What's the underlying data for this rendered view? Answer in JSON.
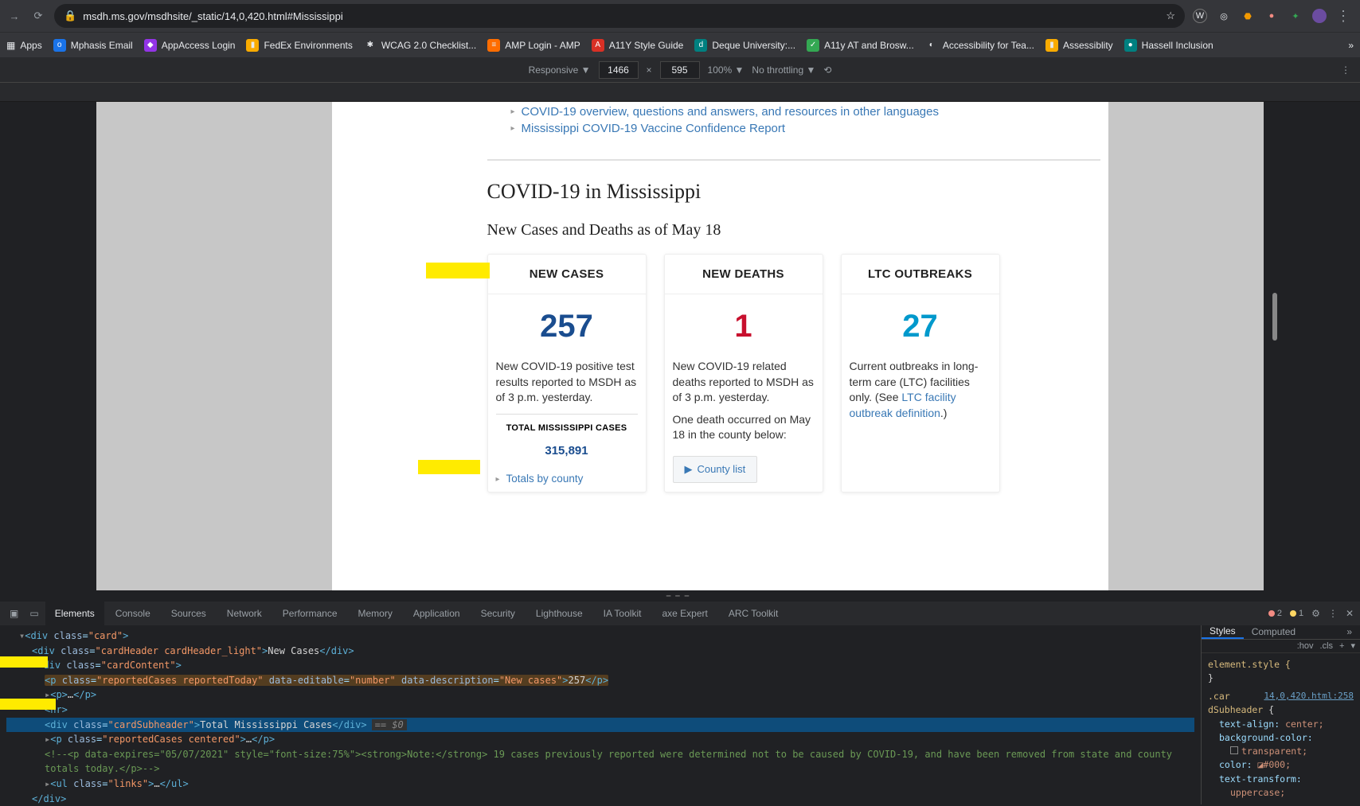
{
  "browser": {
    "url": "msdh.ms.gov/msdhsite/_static/14,0,420.html#Mississippi",
    "star_icon": "star-icon",
    "ext_icons": [
      "wallet",
      "eye",
      "shield",
      "lock",
      "puzzle",
      "avatar"
    ],
    "apps_label": "Apps",
    "bookmarks": [
      {
        "label": "Mphasis Email",
        "color": "bm-blue"
      },
      {
        "label": "AppAccess Login",
        "color": "bm-purple"
      },
      {
        "label": "FedEx Environments",
        "color": "bm-yellow"
      },
      {
        "label": "WCAG 2.0 Checklist...",
        "color": ""
      },
      {
        "label": "AMP Login - AMP",
        "color": "bm-orange"
      },
      {
        "label": "A11Y Style Guide",
        "color": "bm-red"
      },
      {
        "label": "Deque University:...",
        "color": "bm-teal"
      },
      {
        "label": "A11y AT and Brosw...",
        "color": "bm-green"
      },
      {
        "label": "Accessibility for Tea...",
        "color": ""
      },
      {
        "label": "Assessiblity",
        "color": "bm-yellow"
      },
      {
        "label": "Hassell Inclusion",
        "color": "bm-teal"
      }
    ]
  },
  "devicebar": {
    "device": "Responsive ▼",
    "width": "1466",
    "x": "×",
    "height": "595",
    "zoom": "100% ▼",
    "throttle": "No throttling ▼"
  },
  "page": {
    "link1": "COVID-19 overview, questions and answers, and resources in other languages",
    "link2": "Mississippi COVID-19 Vaccine Confidence Report",
    "h2": "COVID-19 in Mississippi",
    "h3": "New Cases and Deaths as of May 18",
    "cards": {
      "new_cases": {
        "title": "NEW CASES",
        "value": "257",
        "desc": "New COVID-19 positive test results reported to MSDH as of 3 p.m. yesterday.",
        "sub_title": "TOTAL MISSISSIPPI CASES",
        "sub_value": "315,891",
        "link": "Totals by county"
      },
      "new_deaths": {
        "title": "NEW DEATHS",
        "value": "1",
        "desc": "New COVID-19 related deaths reported to MSDH as of 3 p.m. yesterday.",
        "note": "One death occurred on May 18 in the county below:",
        "link": "County list"
      },
      "ltc": {
        "title": "LTC OUTBREAKS",
        "value": "27",
        "desc_a": "Current outbreaks in long-term care (LTC) facilities only. (See ",
        "desc_link": "LTC facility outbreak definition",
        "desc_b": ".)"
      }
    }
  },
  "devtools": {
    "tabs": [
      "Elements",
      "Console",
      "Sources",
      "Network",
      "Performance",
      "Memory",
      "Application",
      "Security",
      "Lighthouse",
      "IA Toolkit",
      "axe Expert",
      "ARC Toolkit"
    ],
    "errors": "2",
    "warnings": "1",
    "code": {
      "l0a": "▾<div class=\"",
      "l0b": "card",
      "l0c": "\">",
      "l1a": "<div class=\"",
      "l1b": "cardHeader cardHeader_light",
      "l1c": "\">New Cases</div>",
      "l2a": "▾<div class=\"",
      "l2b": "cardContent",
      "l2c": "\">",
      "l3a": "<p class=\"",
      "l3b": "reportedCases reportedToday",
      "l3c": "\" data-editable=\"",
      "l3d": "number",
      "l3e": "\" data-description=\"",
      "l3f": "New cases",
      "l3g": "\">257</p>",
      "l4": "▸<p>…</p>",
      "l5": "<hr>",
      "l6a": "<div class=\"",
      "l6b": "cardSubheader",
      "l6c": "\">Total Mississippi Cases</div>",
      "l6m": "== $0",
      "l7a": "▸<p class=\"",
      "l7b": "reportedCases centered",
      "l7c": "\">…</p>",
      "l8": "<!--<p data-expires=\"05/07/2021\" style=\"font-size:75%\"><strong>Note:</strong> 19 cases previously reported were determined not to be caused by COVID-19, and have been removed from state and county totals today.</p>-->",
      "l9a": "▸<ul class=\"",
      "l9b": "links",
      "l9c": "\">…</ul>",
      "l10": "</div>"
    },
    "styles": {
      "tab1": "Styles",
      "tab2": "Computed",
      "hov": ":hov",
      "cls": ".cls",
      "elstyle": "element.style {",
      "close": "}",
      "src": "14,0,420.html:258",
      "sel": ".car dSubheader {",
      "p1n": "text-align:",
      "p1v": " center;",
      "p2n": "background-color:",
      "p2v": "transparent;",
      "p3n": "color:",
      "p3v": " ◪#000;",
      "p4n": "text-transform:",
      "p4v": "uppercase;"
    }
  }
}
